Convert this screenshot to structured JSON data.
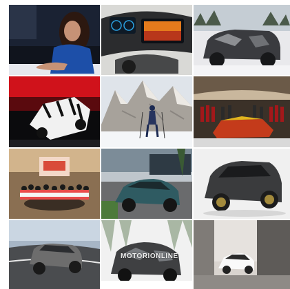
{
  "gallery": {
    "tiles": [
      {
        "subject": "woman-at-desk",
        "accent": "#1d4fa8"
      },
      {
        "subject": "car-dashboard-screens",
        "accent": "#2aa0e0"
      },
      {
        "subject": "camouflaged-suv-in-snow",
        "accent": "#e9e9ec"
      },
      {
        "subject": "race-car-red-lights",
        "accent": "#d0121b"
      },
      {
        "subject": "skier-mountains",
        "accent": "#8aa0b8"
      },
      {
        "subject": "race-car-presentation",
        "accent": "#c43b1b"
      },
      {
        "subject": "group-photo-stage",
        "accent": "#d2b48c"
      },
      {
        "subject": "teal-hatchback",
        "accent": "#2f5b62"
      },
      {
        "subject": "dark-suv-studio",
        "accent": "#3a3b3d"
      },
      {
        "subject": "suv-on-road",
        "accent": "#6d6d6d"
      },
      {
        "subject": "prototype-in-snowy-forest",
        "accent": "#f1f1f1"
      },
      {
        "subject": "white-car-architecture",
        "accent": "#fafafa"
      }
    ],
    "watermark": "MOTORIONLINE"
  }
}
